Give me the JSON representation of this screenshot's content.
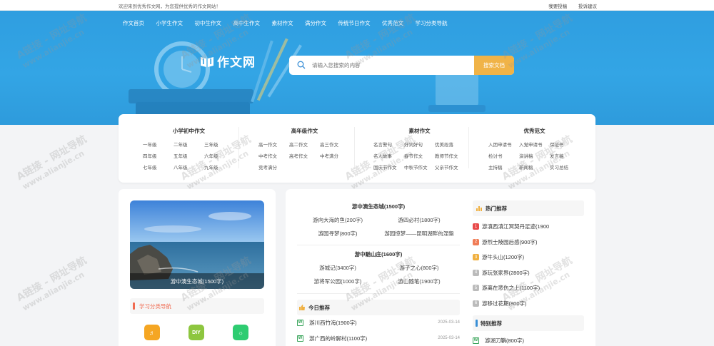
{
  "topbar": {
    "welcome": "欢迎来到优秀作文网，为您提供优秀的作文网站！",
    "links": [
      "我要投稿",
      "投诉建议"
    ]
  },
  "nav": [
    "作文首页",
    "小学生作文",
    "初中生作文",
    "高中生作文",
    "素材作文",
    "满分作文",
    "传统节日作文",
    "优秀范文",
    "学习分类导航"
  ],
  "logo": {
    "text": "作文网"
  },
  "search": {
    "placeholder": "请输入您搜索的内容",
    "button": "搜索文档"
  },
  "categories": [
    {
      "title": "小学初中作文",
      "items": [
        "一年级",
        "二年级",
        "三年级",
        "四年级",
        "五年级",
        "六年级",
        "七年级",
        "八年级",
        "九年级"
      ]
    },
    {
      "title": "高年级作文",
      "items": [
        "高一作文",
        "高二作文",
        "高三作文",
        "中考作文",
        "高考作文",
        "中考满分",
        "竞考满分"
      ]
    },
    {
      "title": "素材作文",
      "items": [
        "名言警句",
        "好词好句",
        "优美段落",
        "名人故事",
        "春节作文",
        "教师节作文",
        "国庆节作文",
        "中秋节作文",
        "父亲节作文"
      ]
    },
    {
      "title": "优秀范文",
      "items": [
        "入团申请书",
        "入党申请书",
        "保证书",
        "检讨书",
        "演讲稿",
        "发言稿",
        "主持稿",
        "新闻稿",
        "实习总结"
      ]
    }
  ],
  "featured": {
    "caption": "游中澳生态城(1500字)"
  },
  "left_section": {
    "title": "学习分类导航"
  },
  "apps": [
    {
      "name": "music-icon",
      "color": "#f5a623",
      "glyph": "♬"
    },
    {
      "name": "diy-icon",
      "color": "#8dc63f",
      "glyph": "DIY"
    },
    {
      "name": "sun-icon",
      "color": "#2ecc71",
      "glyph": "☼"
    }
  ],
  "groups": [
    {
      "title": "游中澳生态城(1500字)",
      "rows": [
        [
          "游向大海的鱼(200字)",
          "游四必村(1800字)"
        ],
        [
          "游园寻梦(800字)",
          "游园惊梦——昆明湖畔的涅槃"
        ]
      ]
    },
    {
      "title": "游中馳山庄(1600字)",
      "rows": [
        [
          "游城记(3400字)",
          "游子之心(800字)"
        ],
        [
          "游将军公园(1000字)",
          "游山随笔(1900字)"
        ]
      ]
    }
  ],
  "today": {
    "title": "今日推荐",
    "items": [
      {
        "title": "游川西竹海(1900字)",
        "date": "2025-03-14"
      },
      {
        "title": "游广西的岭脚村(1100字)",
        "date": "2025-03-14"
      }
    ]
  },
  "hot": {
    "title": "热门推荐",
    "items": [
      {
        "n": "1",
        "title": "游滇西滇江冥契丹足迹(1900",
        "color": "#e84a4a"
      },
      {
        "n": "2",
        "title": "游烈士陵园后感(900字)",
        "color": "#f07c56"
      },
      {
        "n": "3",
        "title": "游牛头山(1200字)",
        "color": "#f0b040"
      },
      {
        "n": "4",
        "title": "游玩张家界(2800字)",
        "color": "#bbbbbb"
      },
      {
        "n": "5",
        "title": "游离在悲伤之上(1100字)",
        "color": "#bbbbbb"
      },
      {
        "n": "6",
        "title": "游移过花期(800字)",
        "color": "#bbbbbb"
      }
    ]
  },
  "special": {
    "title": "特别推荐",
    "items": [
      {
        "title": "游湖刀鞘(800字)"
      }
    ]
  },
  "watermark": {
    "line1": "A链接 - 网址导航",
    "line2": "www.alianjie.cn"
  }
}
